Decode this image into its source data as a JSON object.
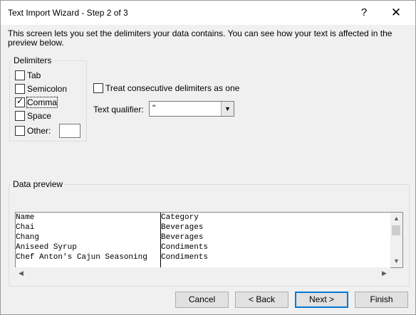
{
  "window": {
    "title": "Text Import Wizard - Step 2 of 3",
    "help_label": "?",
    "close_label": "✕"
  },
  "description": "This screen lets you set the delimiters your data contains.  You can see how your text is affected in the preview below.",
  "delimiters": {
    "group_label": "Delimiters",
    "tab": {
      "label": "Tab",
      "checked": false
    },
    "semicolon": {
      "label": "Semicolon",
      "checked": false
    },
    "comma": {
      "label": "Comma",
      "checked": true
    },
    "space": {
      "label": "Space",
      "checked": false
    },
    "other": {
      "label": "Other:",
      "checked": false,
      "value": ""
    }
  },
  "consecutive": {
    "label": "Treat consecutive delimiters as one",
    "checked": false
  },
  "qualifier": {
    "label": "Text qualifier:",
    "value": "\""
  },
  "preview": {
    "group_label": "Data preview",
    "columns": [
      [
        "Name",
        "Chai",
        "Chang",
        "Aniseed Syrup",
        "Chef Anton's Cajun Seasoning"
      ],
      [
        "Category",
        "Beverages",
        "Beverages",
        "Condiments",
        "Condiments"
      ]
    ]
  },
  "buttons": {
    "cancel": "Cancel",
    "back": "< Back",
    "next": "Next >",
    "finish": "Finish"
  }
}
